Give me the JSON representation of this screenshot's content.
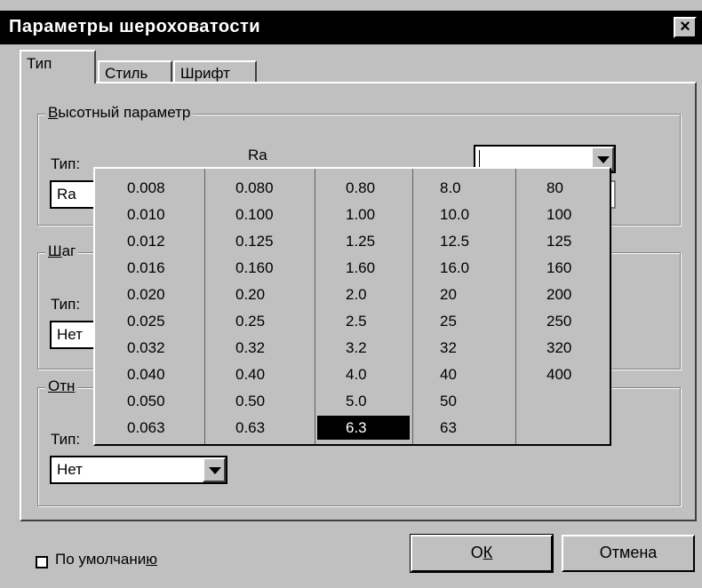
{
  "window": {
    "title": "Параметры шероховатости",
    "close_symbol": "×"
  },
  "tabs": [
    {
      "label": "Тип",
      "active": true
    },
    {
      "label": "Стиль",
      "active": false
    },
    {
      "label": "Шрифт",
      "active": false
    }
  ],
  "group_height": {
    "legend_prefix": "В",
    "legend_rest": "ысотный параметр",
    "type_label": "Тип:",
    "type_value": "Ra",
    "ra_label": "Ra",
    "value_combo": ""
  },
  "group_step": {
    "legend_prefix": "Ш",
    "legend_rest": "аг",
    "type_label": "Тип:",
    "type_value": "Нет"
  },
  "group_rel": {
    "legend_prefix": "Отн",
    "type_label": "Тип:",
    "type_value": "Нет"
  },
  "value_grid": {
    "columns": [
      [
        "0.008",
        "0.010",
        "0.012",
        "0.016",
        "0.020",
        "0.025",
        "0.032",
        "0.040",
        "0.050",
        "0.063"
      ],
      [
        "0.080",
        "0.100",
        "0.125",
        "0.160",
        "0.20",
        "0.25",
        "0.32",
        "0.40",
        "0.50",
        "0.63"
      ],
      [
        "0.80",
        "1.00",
        "1.25",
        "1.60",
        "2.0",
        "2.5",
        "3.2",
        "4.0",
        "5.0",
        "6.3"
      ],
      [
        "8.0",
        "10.0",
        "12.5",
        "16.0",
        "20",
        "25",
        "32",
        "40",
        "50",
        "63"
      ],
      [
        "80",
        "100",
        "125",
        "160",
        "200",
        "250",
        "320",
        "400"
      ]
    ],
    "selected": "6.3"
  },
  "footer": {
    "default_checkbox_prefix": "По умолчани",
    "default_checkbox_underlined": "ю",
    "ok_prefix": "О",
    "ok_underlined": "К",
    "cancel_label": "Отмена"
  }
}
